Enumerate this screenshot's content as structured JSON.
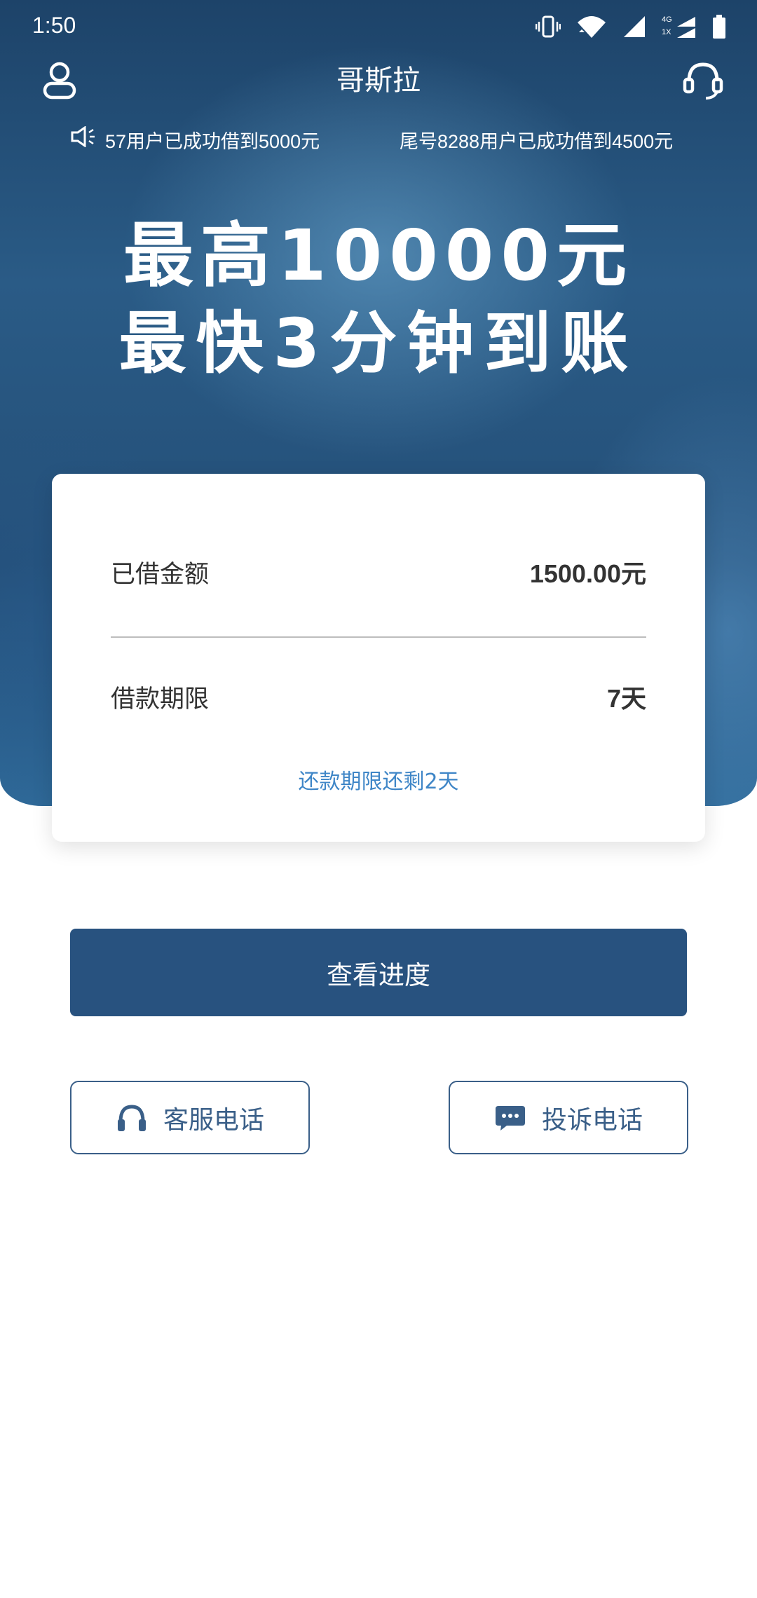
{
  "status_bar": {
    "time": "1:50",
    "network_top": "4G",
    "network_bottom": "1X"
  },
  "header": {
    "title": "哥斯拉"
  },
  "ticker": {
    "messages": [
      "57用户已成功借到5000元",
      "尾号8288用户已成功借到4500元"
    ]
  },
  "banner": {
    "line1": "最高10000元",
    "line2": "最快3分钟到账"
  },
  "loan_card": {
    "amount_label": "已借金额",
    "amount_value": "1500.00元",
    "term_label": "借款期限",
    "term_value": "7天",
    "remaining_note": "还款期限还剩2天"
  },
  "actions": {
    "primary_label": "查看进度",
    "customer_service_label": "客服电话",
    "complaint_label": "投诉电话"
  },
  "colors": {
    "brand": "#28527f",
    "accent_link": "#3f86c7",
    "outline": "#3a5f88"
  },
  "icons": {
    "user": "user-icon",
    "support": "headset-icon",
    "speaker": "speaker-icon",
    "chat": "chat-bubble-icon"
  }
}
